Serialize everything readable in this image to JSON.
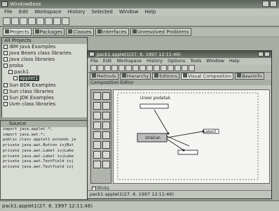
{
  "main_window": {
    "title": "WindowBase",
    "menu": [
      "File",
      "Edit",
      "Workspace",
      "History",
      "Selected",
      "Window",
      "Help"
    ]
  },
  "tabs": [
    "Projects",
    "Packages",
    "Classes",
    "Interfaces",
    "Unresolved Problems"
  ],
  "tree": {
    "header": "All Projects",
    "items": [
      {
        "label": "IBM Java Examples",
        "indent": 0,
        "selected": false
      },
      {
        "label": "Java Beans class libraries",
        "indent": 0,
        "selected": false
      },
      {
        "label": "Java class libraries",
        "indent": 0,
        "selected": false
      },
      {
        "label": "proba",
        "indent": 0,
        "selected": false
      },
      {
        "label": "pack1",
        "indent": 1,
        "selected": false
      },
      {
        "label": "applet1",
        "indent": 2,
        "selected": true
      },
      {
        "label": "Sun BDK Examples",
        "indent": 0,
        "selected": false
      },
      {
        "label": "Sun class libraries",
        "indent": 0,
        "selected": false
      },
      {
        "label": "Sun JDK Examples",
        "indent": 0,
        "selected": false
      },
      {
        "label": "Uvm class libraries",
        "indent": 0,
        "selected": false
      }
    ]
  },
  "source": {
    "title": "Source",
    "lines": [
      "import java.applet.*;",
      "import java.awt.*;",
      "public class applet1 extends ja",
      "  private java.awt.Button ivjBut",
      "  private java.awt.Label ivjLabe",
      "  private java.awt.Label ivjLabe",
      "  private java.awt.TextField ivj",
      "  private java.awt.Textfield ivj"
    ]
  },
  "status": "pack1.applet1(27. 6. 1997 12:11:46)",
  "composition_window": {
    "title": "pack1.applet1(27. 6. 1997 12:11:46)",
    "menu": [
      "File",
      "Edit",
      "Workspace",
      "History",
      "Options",
      "Tools",
      "Window",
      "Help"
    ],
    "tabs": [
      "Methods",
      "Hierarchy",
      "Editions",
      "Visual Composition",
      "BeanInfo"
    ],
    "composition_label": "Composition Editor",
    "canvas": {
      "prompt_label": "Unesi podatak",
      "button_label": "izračun",
      "output_label": "Label2"
    },
    "checkbox_label": "Sticky",
    "status": "pack1.applet1(27. 6. 1997 12:11:46)"
  },
  "colors": {
    "title_bar": "#5a6158",
    "selection": "#2f3a33",
    "desktop": "#8f968e"
  }
}
